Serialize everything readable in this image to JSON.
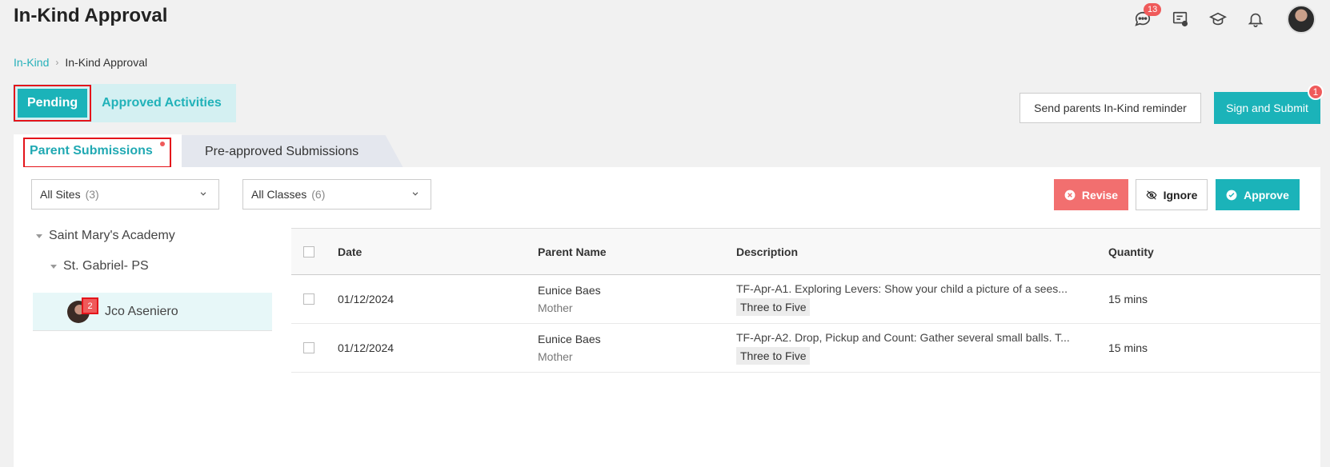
{
  "page": {
    "title": "In-Kind Approval"
  },
  "topbar": {
    "chat_badge": "13"
  },
  "breadcrumb": {
    "parent": "In-Kind",
    "current": "In-Kind Approval"
  },
  "main_tabs": {
    "pending": "Pending",
    "approved": "Approved Activities"
  },
  "actions": {
    "reminder": "Send parents In-Kind reminder",
    "sign": "Sign and Submit",
    "sign_badge": "1"
  },
  "sub_tabs": {
    "parent": "Parent Submissions",
    "preapproved": "Pre-approved Submissions"
  },
  "filters": {
    "sites": {
      "label": "All Sites",
      "count": "(3)"
    },
    "classes": {
      "label": "All Classes",
      "count": "(6)"
    }
  },
  "buttons": {
    "revise": "Revise",
    "ignore": "Ignore",
    "approve": "Approve"
  },
  "tree": {
    "site": "Saint Mary's Academy",
    "class": "St. Gabriel- PS",
    "child": {
      "name": "Jco Aseniero",
      "badge": "2"
    }
  },
  "table": {
    "headers": {
      "date": "Date",
      "parent": "Parent Name",
      "description": "Description",
      "quantity": "Quantity"
    },
    "rows": [
      {
        "date": "01/12/2024",
        "parent": "Eunice Baes",
        "relation": "Mother",
        "description": "TF-Apr-A1. Exploring Levers: Show your child a picture of a sees...",
        "tag": "Three to Five",
        "quantity": "15 mins"
      },
      {
        "date": "01/12/2024",
        "parent": "Eunice Baes",
        "relation": "Mother",
        "description": "TF-Apr-A2. Drop, Pickup and Count: Gather several small balls. T...",
        "tag": "Three to Five",
        "quantity": "15 mins"
      }
    ]
  },
  "colors": {
    "accent": "#1bb3b9",
    "danger": "#f26f6f",
    "highlight": "#e4141b"
  }
}
